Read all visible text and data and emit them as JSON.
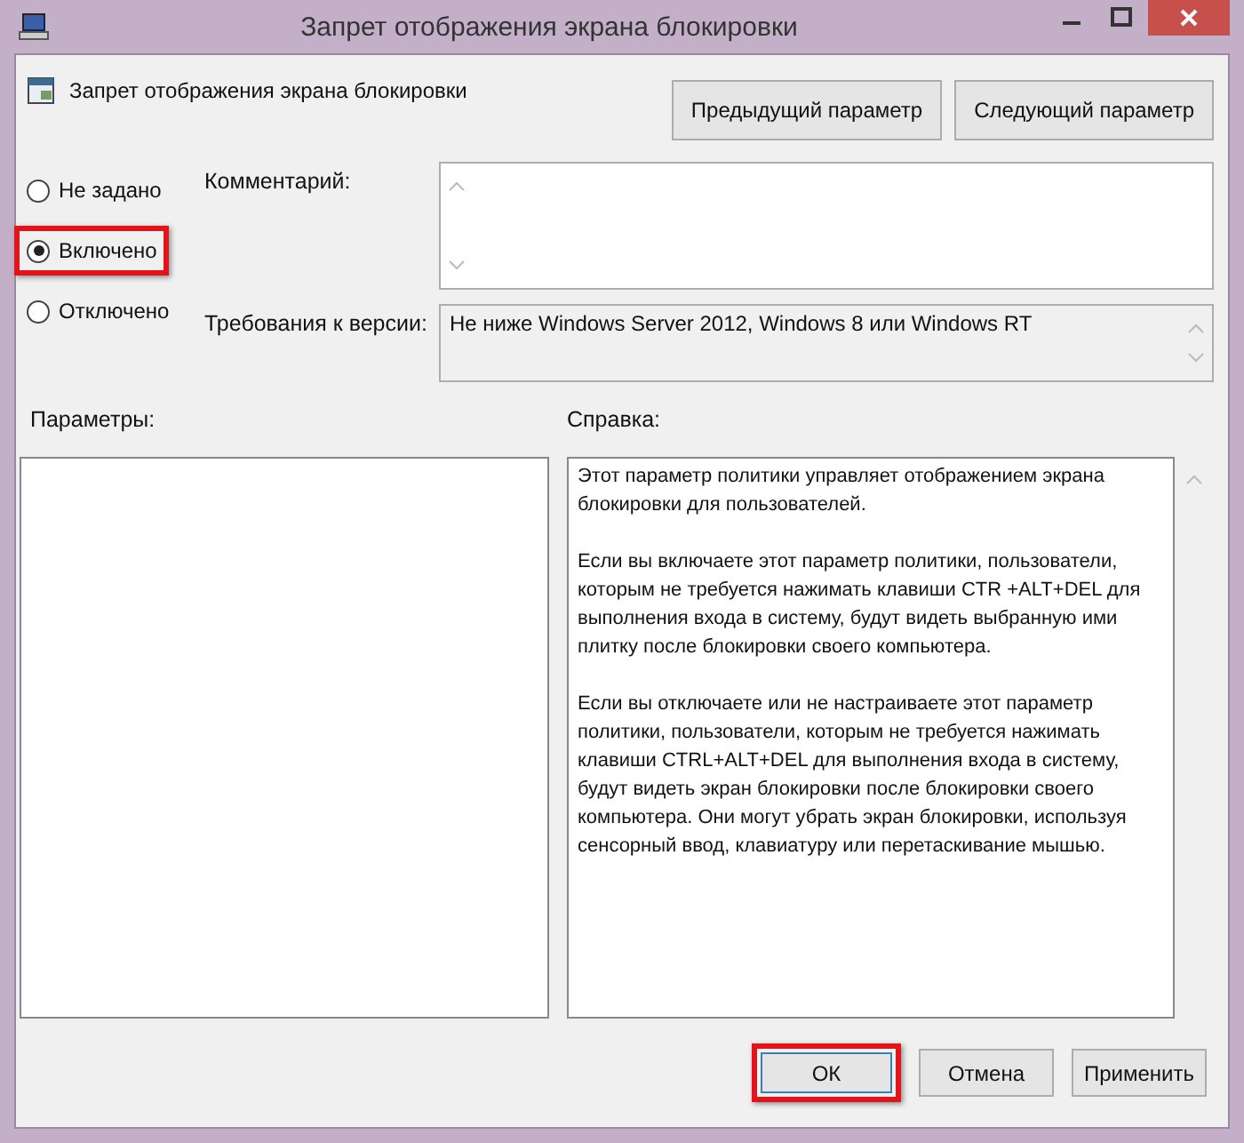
{
  "window": {
    "title": "Запрет отображения экрана блокировки"
  },
  "policy": {
    "name": "Запрет отображения экрана блокировки"
  },
  "nav_buttons": [
    "Предыдущий параметр",
    "Следующий параметр"
  ],
  "options": [
    {
      "label": "Не задано",
      "selected": false,
      "highlighted": false
    },
    {
      "label": "Включено",
      "selected": true,
      "highlighted": true
    },
    {
      "label": "Отключено",
      "selected": false,
      "highlighted": false
    }
  ],
  "comment": {
    "label": "Комментарий:"
  },
  "requirements": {
    "label": "Требования к версии:",
    "value": "Не ниже Windows Server 2012, Windows 8 или Windows RT"
  },
  "parameters": {
    "label": "Параметры:"
  },
  "help": {
    "label": "Справка:",
    "paragraphs": [
      "Этот параметр политики управляет отображением экрана блокировки для пользователей.",
      "Если вы включаете этот параметр политики, пользователи, которым не требуется нажимать клавиши CTR +ALT+DEL для выполнения входа в систему, будут видеть выбранную ими плитку после блокировки своего компьютера.",
      "Если вы отключаете или не настраиваете этот параметр политики, пользователи, которым не требуется нажимать клавиши CTRL+ALT+DEL для выполнения входа в систему, будут видеть экран блокировки после блокировки своего компьютера. Они могут убрать экран блокировки, используя сенсорный ввод, клавиатуру или перетаскивание мышью."
    ]
  },
  "buttons": [
    {
      "label": "ОК",
      "highlighted": true
    },
    {
      "label": "Отмена",
      "highlighted": false
    },
    {
      "label": "Применить",
      "highlighted": false
    }
  ]
}
